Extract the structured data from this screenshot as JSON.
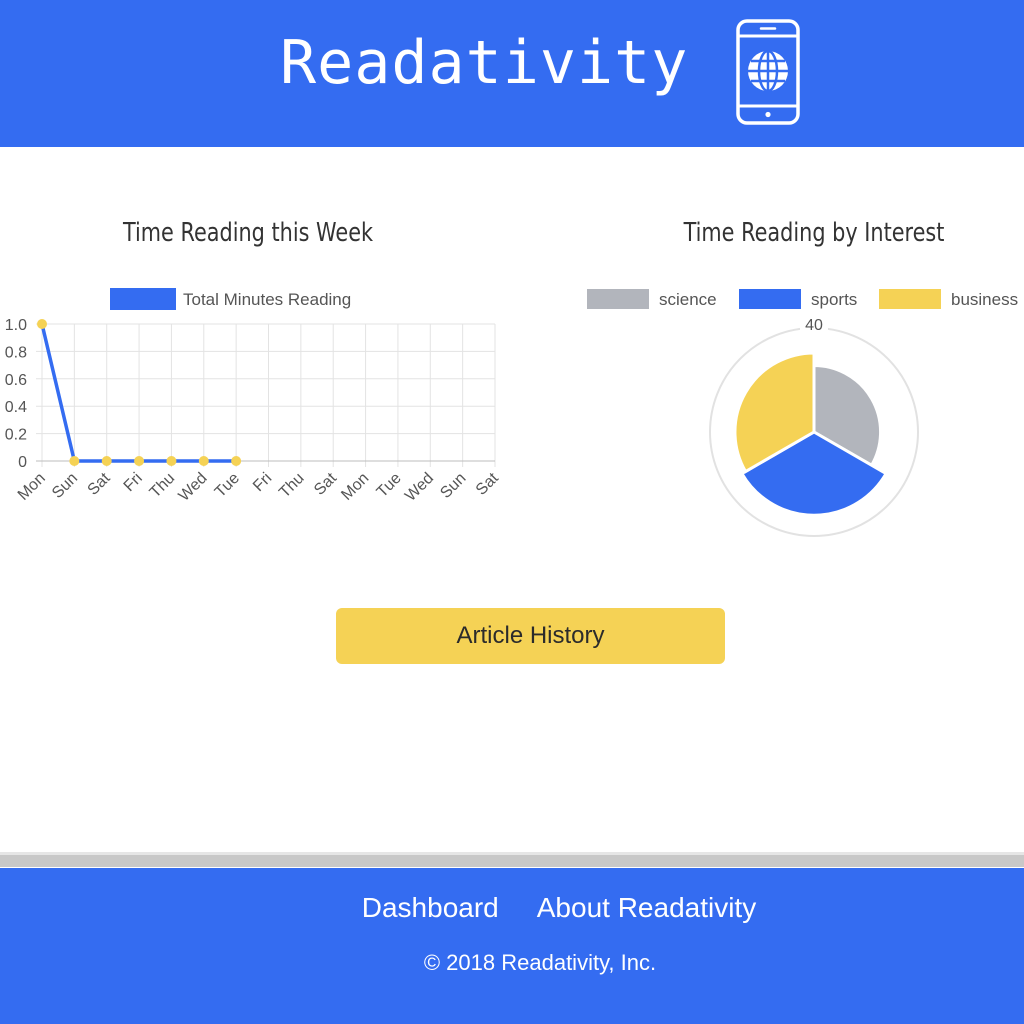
{
  "header": {
    "brand": "Readativity",
    "icon": "smartphone-globe-icon",
    "bg_color": "#346cf1"
  },
  "main": {
    "line_chart_title": "Time Reading this Week",
    "pie_chart_title": "Time Reading by Interest",
    "cta_label": "Article History"
  },
  "chart_data": [
    {
      "type": "line",
      "title": "Time Reading this Week",
      "legend": [
        "Total Minutes Reading"
      ],
      "legend_position": "top",
      "categories": [
        "Mon",
        "Sun",
        "Sat",
        "Fri",
        "Thu",
        "Wed",
        "Tue",
        "Fri",
        "Thu",
        "Sat",
        "Mon",
        "Tue",
        "Wed",
        "Sun",
        "Sat"
      ],
      "series": [
        {
          "name": "Total Minutes Reading",
          "values": [
            1,
            0,
            0,
            0,
            0,
            0,
            0
          ],
          "color": "#346cf1",
          "point_color": "#f5d255"
        }
      ],
      "y_ticks": [
        "0",
        "0.2",
        "0.4",
        "0.6",
        "0.8",
        "1.0"
      ],
      "ylim": [
        0,
        1
      ],
      "grid": true
    },
    {
      "type": "pie",
      "title": "Time Reading by Interest",
      "legend": [
        "science",
        "sports",
        "business"
      ],
      "legend_position": "top",
      "radial_tick_label": "40",
      "series": [
        {
          "name": "science",
          "value": 1,
          "color": "#b2b5bc"
        },
        {
          "name": "sports",
          "value": 1,
          "color": "#346cf1"
        },
        {
          "name": "business",
          "value": 1,
          "color": "#f5d255"
        }
      ],
      "slice_radii": [
        32,
        40,
        38
      ],
      "r_max": 50
    }
  ],
  "footer": {
    "links": [
      "Dashboard",
      "About Readativity"
    ],
    "copyright": "© 2018 Readativity, Inc."
  }
}
